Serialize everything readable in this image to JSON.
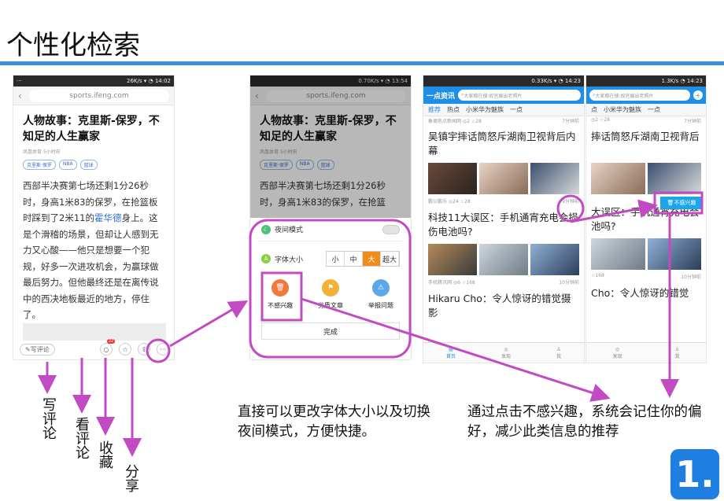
{
  "slide_title": "个性化检索",
  "phone1": {
    "status": {
      "speed": "26K/s",
      "time": "14:02",
      "dots": "···"
    },
    "url": "sports.ifeng.com",
    "article": {
      "title": "人物故事：克里斯-保罗，不知足的人生赢家",
      "source": "凤凰体育",
      "time": "5小时前",
      "tags": [
        "克里斯·保罗",
        "NBA",
        "篮球"
      ],
      "body_pre": "西部半决赛第七场还剩1分26秒时，身高1米83的保罗，在抢篮板时踩到了2米11的",
      "body_link": "霍华德",
      "body_post": "身上。这是个滑稽的场景，但却让人感到无力又心酸——他只是想要一个犯规，好多一次进攻机会，为赢球做最后努力。但他最终还是在离传说中的西决地板最近的地方，停住了。"
    },
    "bottom": {
      "comment_label": "写评论",
      "comment_count": "22"
    }
  },
  "phone2": {
    "status": {
      "speed": "0.70K/s",
      "time": "13:54"
    },
    "url": "sports.ifeng.com",
    "article": {
      "title": "人物故事：克里斯-保罗，不知足的人生赢家",
      "source": "凤凰体育",
      "time": "5小时前",
      "tags": [
        "克里斯·保罗",
        "NBA",
        "篮球"
      ],
      "body": "西部半决赛第七场还剩1分26秒时，身高1米83的保罗，在抢篮"
    },
    "sheet": {
      "night_mode": "夜间模式",
      "font_size": "字体大小",
      "font_options": [
        "小",
        "中",
        "大",
        "超大"
      ],
      "font_selected": "大",
      "actions": [
        {
          "label": "不感兴趣",
          "icon": "trash-icon",
          "color": "#f07a3c"
        },
        {
          "label": "劣质文章",
          "icon": "flag-icon",
          "color": "#f3b13a"
        },
        {
          "label": "举报问题",
          "icon": "warning-icon",
          "color": "#5aa7ea"
        }
      ],
      "done": "完成"
    }
  },
  "phone3": {
    "status": {
      "speed": "0.33K/s",
      "time": "14:23"
    },
    "logo": "一点资讯",
    "search_placeholder": "大家都在搜:故宫展出老照片",
    "tabs": [
      "推荐",
      "热点",
      "小米华为魅族",
      "一点"
    ],
    "items": [
      {
        "meta": "象德热点新闻网 ◎2 ☆28",
        "time": "7分钟前",
        "title": "吴镇宇摔话筒怒斥湖南卫视背后内幕"
      },
      {
        "meta": "鹏公鹏乐 ◎24 ☆28",
        "time": "9分钟前",
        "title": "科技11大误区：手机通宵充电会损伤电池吗?"
      },
      {
        "meta": "手机腾讯网 ◎6 ☆168",
        "time": "10分钟前",
        "title": "Hikaru Cho：令人惊讶的错觉摄影"
      }
    ],
    "nav": [
      "首页",
      "发现",
      "我"
    ]
  },
  "phone4": {
    "status": {
      "speed": "1.3K/s",
      "time": "14:23"
    },
    "search_placeholder": "大家都在搜:故宫展出老照片",
    "tabs": [
      "点",
      "小米华为魅族",
      "一点"
    ],
    "items": [
      {
        "meta": "◎2 ☆28",
        "time": "7分钟前",
        "title": "摔话筒怒斥湖南卫视背后"
      },
      {
        "meta": "☆168",
        "time": "10分钟前",
        "title": "大误区：手机通宵充电会池吗?"
      },
      {
        "meta": "",
        "time": "",
        "title": "Cho：令人惊讶的错觉"
      }
    ],
    "popup": "不感兴趣",
    "nav": [
      "发现",
      "我"
    ]
  },
  "annotations": {
    "write_comment": "写评论",
    "view_comment": "看评论",
    "favorite": "收藏",
    "share": "分享",
    "note_left": "直接可以更改字体大小以及切换夜间模式，方便快捷。",
    "note_right": "通过点击不感兴趣，系统会记住你的偏好，减少此类信息的推荐"
  },
  "slide_number": "1.",
  "colors": {
    "highlight": "#c24bc4",
    "accent": "#1f8fe6",
    "title_bar": "#3d8fe0"
  }
}
